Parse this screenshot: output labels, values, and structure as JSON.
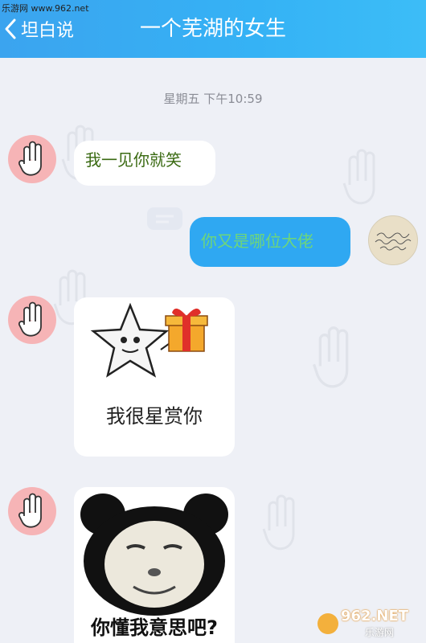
{
  "watermark": {
    "top_text": "乐游网 www.962.net",
    "bottom_brand": "962.NET",
    "bottom_sub": "乐游网"
  },
  "header": {
    "back_label": "坦白说",
    "title": "一个芜湖的女生"
  },
  "chat": {
    "timestamp": "星期五 下午10:59",
    "messages": [
      {
        "side": "left",
        "type": "text",
        "text": "我一见你就笑"
      },
      {
        "side": "right",
        "type": "text",
        "text": "你又是哪位大佬"
      },
      {
        "side": "left",
        "type": "sticker",
        "caption": "我很星赏你"
      },
      {
        "side": "left",
        "type": "sticker",
        "caption": "你懂我意思吧?"
      }
    ]
  },
  "colors": {
    "header": "#38acf3",
    "bubble_right": "#2fa8f2",
    "bubble_left_text": "#3a6a12",
    "bubble_right_text": "#6ed67a",
    "chat_bg": "#eef0f6"
  }
}
